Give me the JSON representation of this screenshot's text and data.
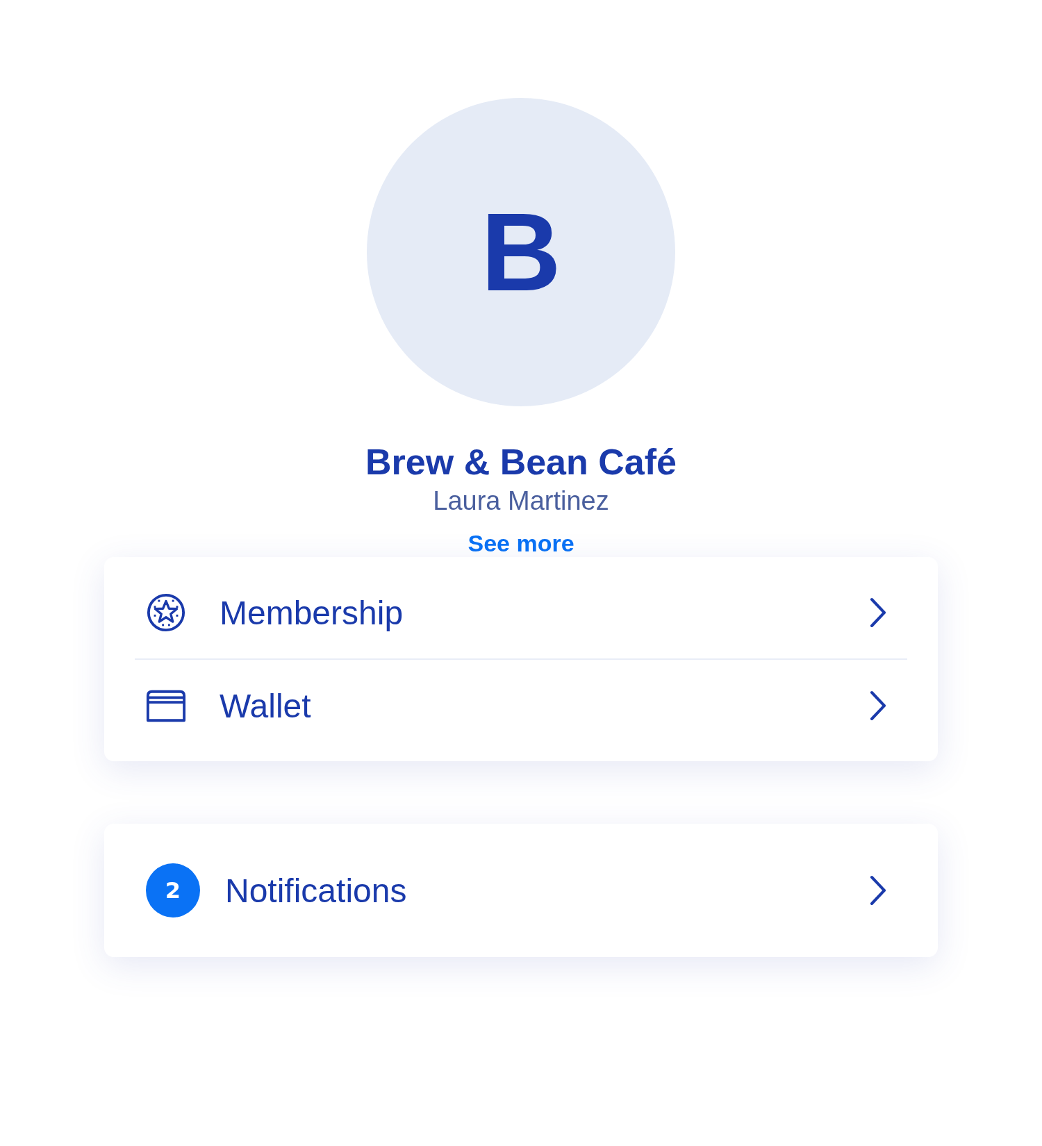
{
  "profile": {
    "initial": "B",
    "business_name": "Brew & Bean Café",
    "owner": "Laura Martinez",
    "link": "See more"
  },
  "cards": [
    {
      "rows": [
        {
          "kind": "membership",
          "label": "Membership"
        },
        {
          "kind": "wallet",
          "label": "Wallet"
        }
      ]
    },
    {
      "rows": [
        {
          "kind": "badge",
          "badge": "2",
          "label": "Notifications"
        }
      ]
    }
  ]
}
